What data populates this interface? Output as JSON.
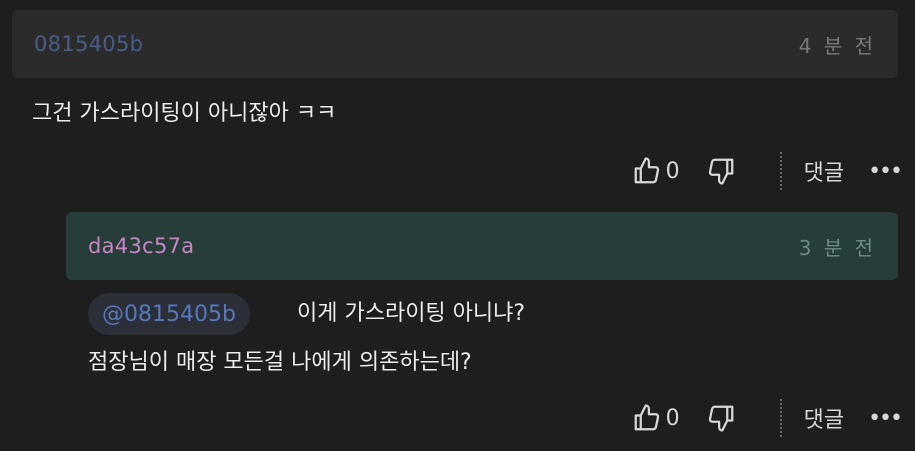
{
  "comments": [
    {
      "author": "0815405b",
      "time": "4 분 전",
      "text": "그건 가스라이팅이 아니잖아 ㅋㅋ",
      "likes": "0",
      "reply_label": "댓글",
      "more": "•••"
    },
    {
      "author": "da43c57a",
      "time": "3 분 전",
      "mention": "@0815405b",
      "line1": "이게 가스라이팅 아니냐?",
      "line2": "점장님이 매장 모든걸 나에게 의존하는데?",
      "likes": "0",
      "reply_label": "댓글",
      "more": "•••"
    }
  ],
  "colors": {
    "background": "#1e1e1f",
    "header_1": "#2b2b2c",
    "header_2": "#263d39",
    "author_1": "#4a5d86",
    "author_2": "#c984c6",
    "mention": "#5577bb"
  },
  "icons": [
    "thumbs-up-icon",
    "thumbs-down-icon"
  ]
}
